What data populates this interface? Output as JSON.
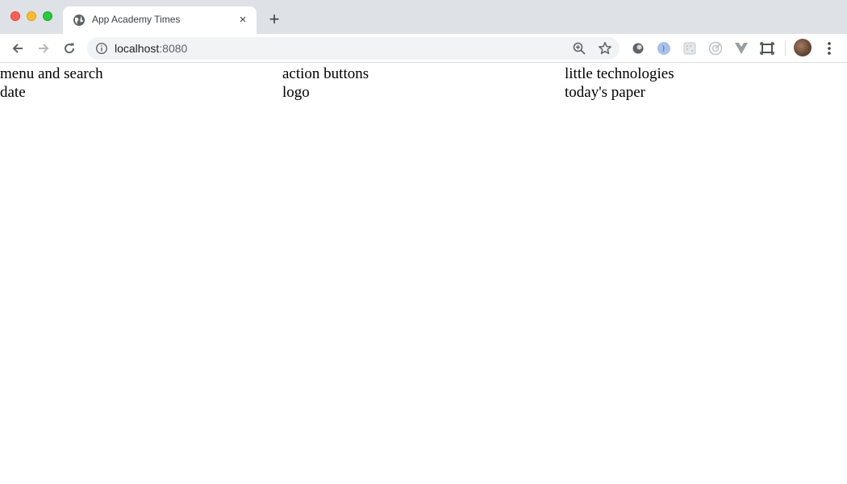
{
  "browser": {
    "tab": {
      "title": "App Academy Times",
      "favicon": "globe-icon",
      "close": "×"
    },
    "new_tab": "+",
    "address": {
      "host": "localhost",
      "port": ":8080"
    },
    "colors": {
      "chrome_bg": "#dee1e6",
      "omnibox_bg": "#f1f3f4",
      "close_red": "#ff5f57",
      "minimize_yellow": "#febc2e",
      "zoom_green": "#28c840"
    }
  },
  "page": {
    "row1": [
      "menu and search",
      "action buttons",
      "little technologies"
    ],
    "row2": [
      "date",
      "logo",
      "today's paper"
    ]
  }
}
